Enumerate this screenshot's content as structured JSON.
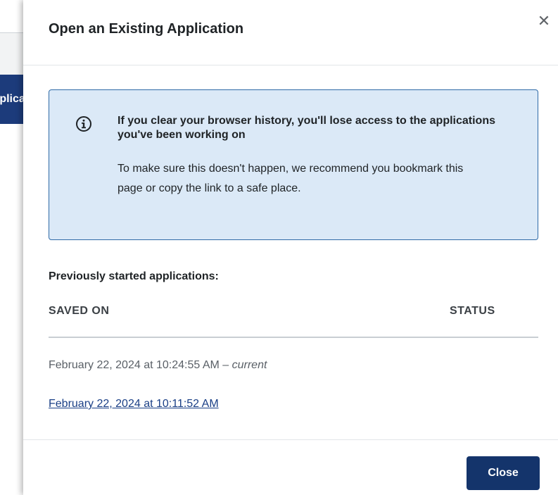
{
  "background": {
    "side_button_label": "Application"
  },
  "modal": {
    "title": "Open an Existing Application",
    "close_icon": "close-icon",
    "alert": {
      "icon": "info-circle-icon",
      "heading": "If you clear your browser history, you'll lose access to the applications you've been working on",
      "body": "To make sure this doesn't happen, we recommend you bookmark this page or copy the link to a safe place."
    },
    "section_heading": "Previously started applications:",
    "columns": {
      "saved_on": "SAVED ON",
      "status": "STATUS"
    },
    "rows": [
      {
        "saved_on": "February 22, 2024 at 10:24:55 AM",
        "separator": " – ",
        "note": "current",
        "link": false
      },
      {
        "saved_on": "February 22, 2024 at 10:11:52 AM",
        "link": true
      }
    ],
    "footer": {
      "close_label": "Close"
    }
  },
  "colors": {
    "primary": "#14346b",
    "alert_bg": "#dbe9f7",
    "alert_border": "#2f6aa7",
    "link": "#1a3f86"
  }
}
